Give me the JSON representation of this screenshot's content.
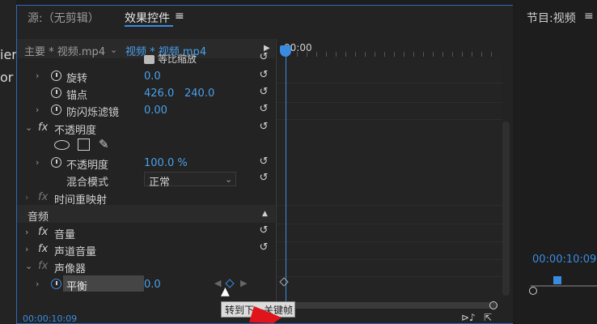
{
  "left_panel": {
    "partial_lines": [
      "ier",
      "or"
    ]
  },
  "tabs": {
    "source": "源:（无剪辑）",
    "effect_controls": "效果控件",
    "menu_icon": "≡",
    "program": "节目:视频",
    "program_menu_icon": "≡"
  },
  "clip_header": {
    "master": "主要 * 视频.mp4",
    "clip": "视频 * 视频.mp4",
    "timecode": ":00:00"
  },
  "effects": {
    "uniform_scale": "等比缩放",
    "rotation_label": "旋转",
    "rotation_value": "0.0",
    "anchor_label": "锚点",
    "anchor_x": "426.0",
    "anchor_y": "240.0",
    "antiflicker_label": "防闪烁滤镜",
    "antiflicker_value": "0.00",
    "opacity_group": "不透明度",
    "opacity_label": "不透明度",
    "opacity_value": "100.0 %",
    "blend_label": "混合模式",
    "blend_value": "正常",
    "time_remap": "时间重映射",
    "audio_section": "音频",
    "volume": "音量",
    "channel_volume": "声道音量",
    "panner": "声像器",
    "balance_label": "平衡",
    "balance_value": "0.0"
  },
  "fx_label": "fx",
  "tooltip": "转到下一关键帧",
  "status": {
    "timecode": "00:00:10:09"
  },
  "program_monitor": {
    "timecode": "00:00:10:09"
  },
  "colors": {
    "accent": "#3a8bdf",
    "value_blue": "#4a9fea",
    "arrow_red": "#e0141b"
  }
}
